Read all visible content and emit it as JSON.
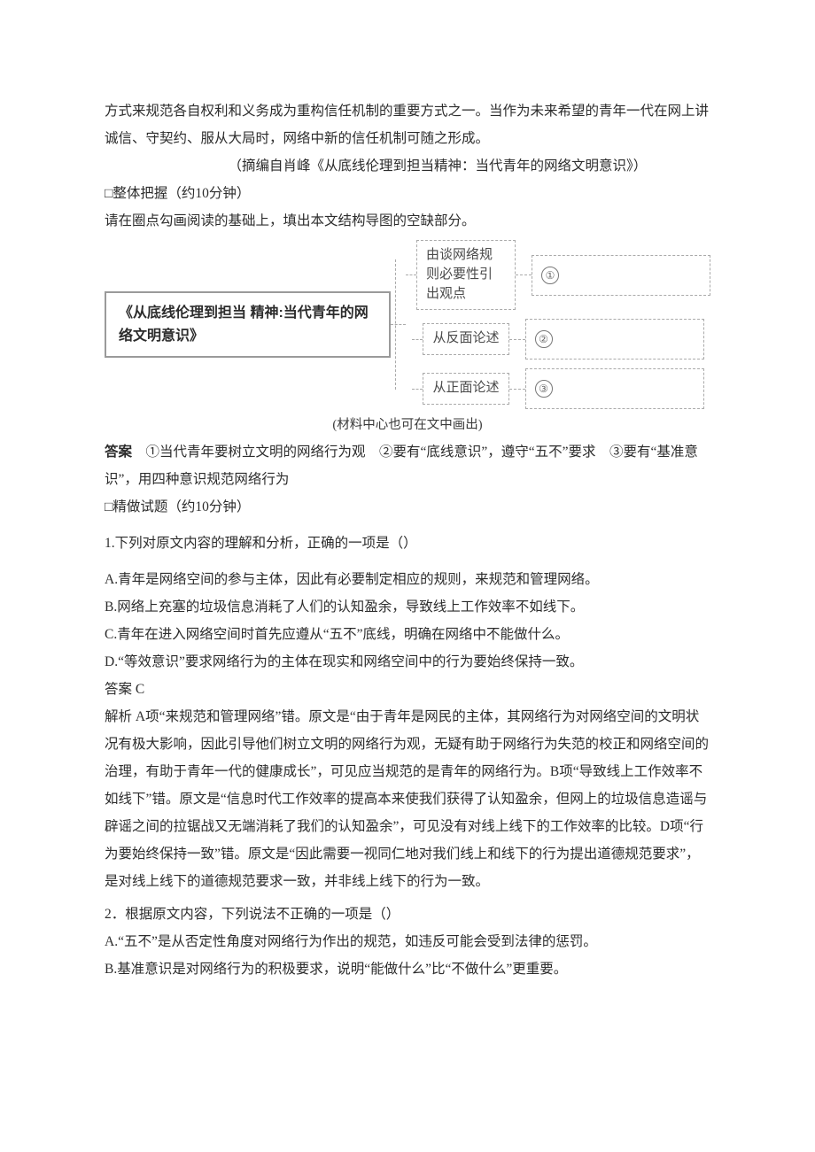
{
  "intro": {
    "p1": "方式来规范各自权利和义务成为重构信任机制的重要方式之一。当作为未来希望的青年一代在网上讲诚信、守契约、服从大局时，网络中新的信任机制可随之形成。",
    "citation": "（摘编自肖峰《从底线伦理到担当精神：当代青年的网络文明意识》）",
    "section_label": "□整体把握（约10分钟）",
    "instruction": "请在圈点勾画阅读的基础上，填出本文结构导图的空缺部分。"
  },
  "diagram": {
    "left": "《从底线伦理到担当\n精神:当代青年的网\n络文明意识》",
    "mid1": "由谈网络规\n则必要性引\n出观点",
    "mid2": "从反面论述",
    "mid3": "从正面论述",
    "num1": "①",
    "num2": "②",
    "num3": "③",
    "caption": "(材料中心也可在文中画出)"
  },
  "answer": {
    "label": "答案",
    "text": "　①当代青年要树立文明的网络行为观　②要有“底线意识”，遵守“五不”要求　③要有“基准意识”，用四种意识规范网络行为"
  },
  "section2_label": "□精做试题（约10分钟）",
  "q1": {
    "stem": "1.下列对原文内容的理解和分析，正确的一项是（）",
    "A": "A.青年是网络空间的参与主体，因此有必要制定相应的规则，来规范和管理网络。",
    "B": "B.网络上充塞的垃圾信息消耗了人们的认知盈余，导致线上工作效率不如线下。",
    "C": "C.青年在进入网络空间时首先应遵从“五不”底线，明确在网络中不能做什么。",
    "D": "D.“等效意识”要求网络行为的主体在现实和网络空间中的行为要始终保持一致。",
    "ans_label": "答案 C",
    "exp": "解析 A项“来规范和管理网络”错。原文是“由于青年是网民的主体，其网络行为对网络空间的文明状况有极大影响，因此引导他们树立文明的网络行为观，无疑有助于网络行为失范的校正和网络空间的治理，有助于青年一代的健康成长”，可见应当规范的是青年的网络行为。B项“导致线上工作效率不如线下”错。原文是“信息时代工作效率的提高本来使我们获得了认知盈余，但网上的垃圾信息造谣与辟谣之间的拉锯战又无端消耗了我们的认知盈余”，可见没有对线上线下的工作效率的比较。D项“行为要始终保持一致”错。原文是“因此需要一视同仁地对我们线上和线下的行为提出道德规范要求”，是对线上线下的道德规范要求一致，并非线上线下的行为一致。"
  },
  "q2": {
    "stem": "2．根据原文内容，下列说法不正确的一项是（）",
    "A": "A.“五不”是从否定性角度对网络行为作出的规范，如违反可能会受到法律的惩罚。",
    "B": "B.基准意识是对网络行为的积极要求，说明“能做什么”比“不做什么”更重要。"
  }
}
